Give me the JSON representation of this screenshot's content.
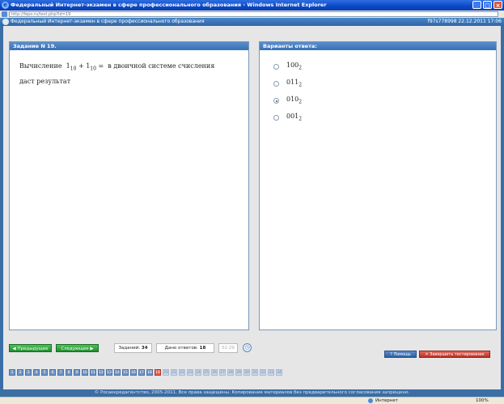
{
  "window": {
    "title": "Федеральный Интернет-экзамен в сфере профессионального образования - Windows Internet Explorer",
    "url": "http://fepo.ru/test.php?id=19"
  },
  "app": {
    "title": "Федеральный Интернет-экзамен в сфере профессионального образования",
    "session": "f97s778998 22.12.2011 17:06"
  },
  "question": {
    "header": "Задание N 19.",
    "text_before": "Вычисление",
    "expr_a": "1",
    "expr_a_sub": "10",
    "plus": "+",
    "expr_b": "1",
    "expr_b_sub": "10",
    "equals": "=",
    "text_after": "в двоичной системе счисления даст результат"
  },
  "answers": {
    "header": "Варианты ответа:",
    "options": [
      {
        "value": "100",
        "sub": "2",
        "selected": false
      },
      {
        "value": "011",
        "sub": "2",
        "selected": false
      },
      {
        "value": "010",
        "sub": "2",
        "selected": true
      },
      {
        "value": "001",
        "sub": "2",
        "selected": false
      }
    ]
  },
  "controls": {
    "prev_label": "Предыдущее",
    "next_label": "Следующее",
    "tasks_label": "Заданий:",
    "tasks_count": "34",
    "answered_label": "Дано ответов:",
    "answered_count": "18",
    "timer": "52:29",
    "help_label": "Помощь",
    "finish_label": "Завершить тестирование"
  },
  "task_numbers": [
    "1",
    "2",
    "3",
    "4",
    "5",
    "6",
    "7",
    "8",
    "9",
    "10",
    "11",
    "12",
    "13",
    "14",
    "15",
    "16",
    "17",
    "18",
    "19",
    "20",
    "21",
    "22",
    "23",
    "24",
    "25",
    "26",
    "27",
    "28",
    "29",
    "30",
    "31",
    "32",
    "33",
    "34"
  ],
  "current_task": 19,
  "footer": "© Росаккредагентство, 2005-2011. Все права защищены. Копирование материалов без предварительного согласования запрещено.",
  "statusbar": {
    "zone": "Интернет",
    "zoom": "100%"
  },
  "colors": {
    "header_blue": "#386fb5",
    "nav_green": "#1f8f2c",
    "finish_red": "#b83226",
    "current_task": "#e45c50"
  }
}
